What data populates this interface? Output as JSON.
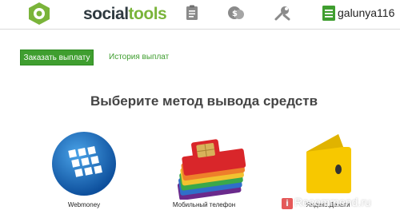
{
  "header": {
    "logo_text_prefix": "social",
    "logo_text_suffix": "tools",
    "nav_icons": [
      "clipboard-icon",
      "coins-icon",
      "tools-icon",
      "document-icon"
    ],
    "username": "galunya116"
  },
  "actions": {
    "order_payout_label": "Заказать выплату",
    "payout_history_label": "История выплат"
  },
  "main": {
    "heading": "Выберите метод вывода средств",
    "methods": [
      {
        "label": "Webmoney",
        "icon": "webmoney-globe-icon"
      },
      {
        "label": "Мобильный телефон",
        "icon": "sim-cards-icon"
      },
      {
        "label": "Яндекс.Деньги",
        "icon": "yandex-wallet-icon"
      }
    ]
  },
  "watermark": {
    "badge": "i",
    "text": "Recommend.ru"
  },
  "colors": {
    "brand_green": "#3f9e2f",
    "logo_green": "#7ab43a",
    "icon_gray": "#8a8a8a"
  }
}
